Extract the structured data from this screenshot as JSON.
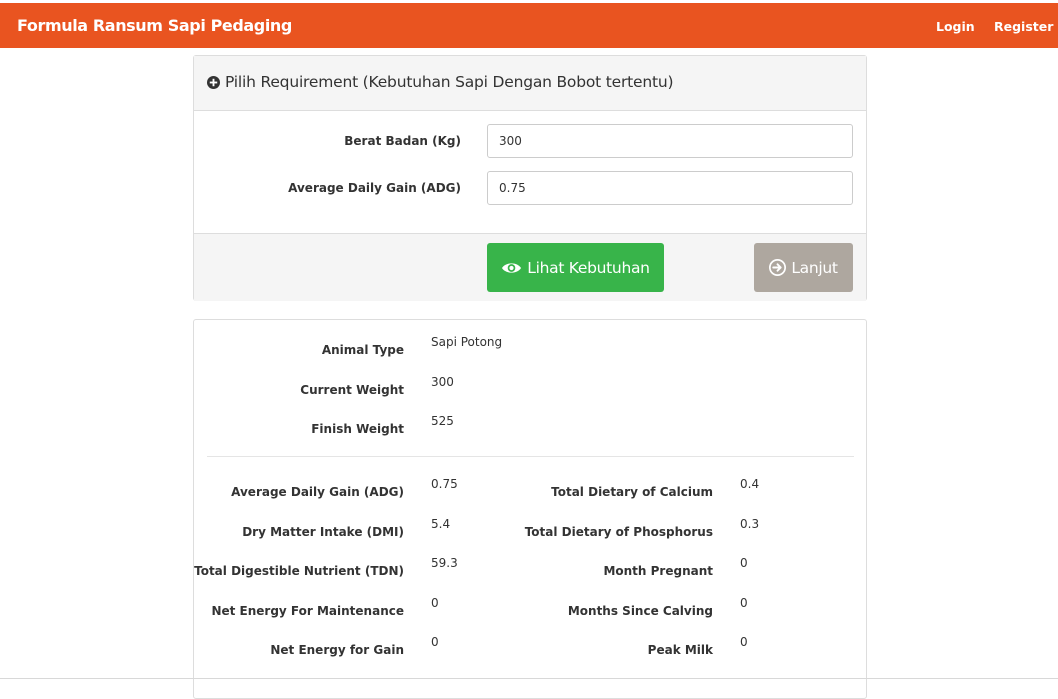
{
  "navbar": {
    "brand": "Formula Ransum Sapi Pedaging",
    "login": "Login",
    "register": "Register",
    "color": "#e95420"
  },
  "requirement_panel": {
    "heading": "Pilih Requirement (Kebutuhan Sapi Dengan Bobot tertentu)",
    "heading_icon": "plus-circle-icon",
    "fields": [
      {
        "label": "Berat Badan (Kg)",
        "value": "300"
      },
      {
        "label": "Average Daily Gain (ADG)",
        "value": "0.75"
      }
    ],
    "buttons": {
      "view": {
        "label": "Lihat Kebutuhan",
        "icon": "eye-icon",
        "color": "#38b44a"
      },
      "next": {
        "label": "Lanjut",
        "icon": "arrow-circle-right-icon",
        "color": "#aea79f"
      }
    }
  },
  "result_panel": {
    "summary": [
      {
        "label": "Animal Type",
        "value": "Sapi Potong"
      },
      {
        "label": "Current Weight",
        "value": "300"
      },
      {
        "label": "Finish Weight",
        "value": "525"
      }
    ],
    "left_column": [
      {
        "label": "Average Daily Gain (ADG)",
        "value": "0.75"
      },
      {
        "label": "Dry Matter Intake (DMI)",
        "value": "5.4"
      },
      {
        "label": "Total Digestible Nutrient (TDN)",
        "value": "59.3"
      },
      {
        "label": "Net Energy For Maintenance",
        "value": "0"
      },
      {
        "label": "Net Energy for Gain",
        "value": "0"
      }
    ],
    "right_column": [
      {
        "label": "Total Dietary of Calcium",
        "value": "0.4"
      },
      {
        "label": "Total Dietary of Phosphorus",
        "value": "0.3"
      },
      {
        "label": "Month Pregnant",
        "value": "0"
      },
      {
        "label": "Months Since Calving",
        "value": "0"
      },
      {
        "label": "Peak Milk",
        "value": "0"
      }
    ]
  }
}
